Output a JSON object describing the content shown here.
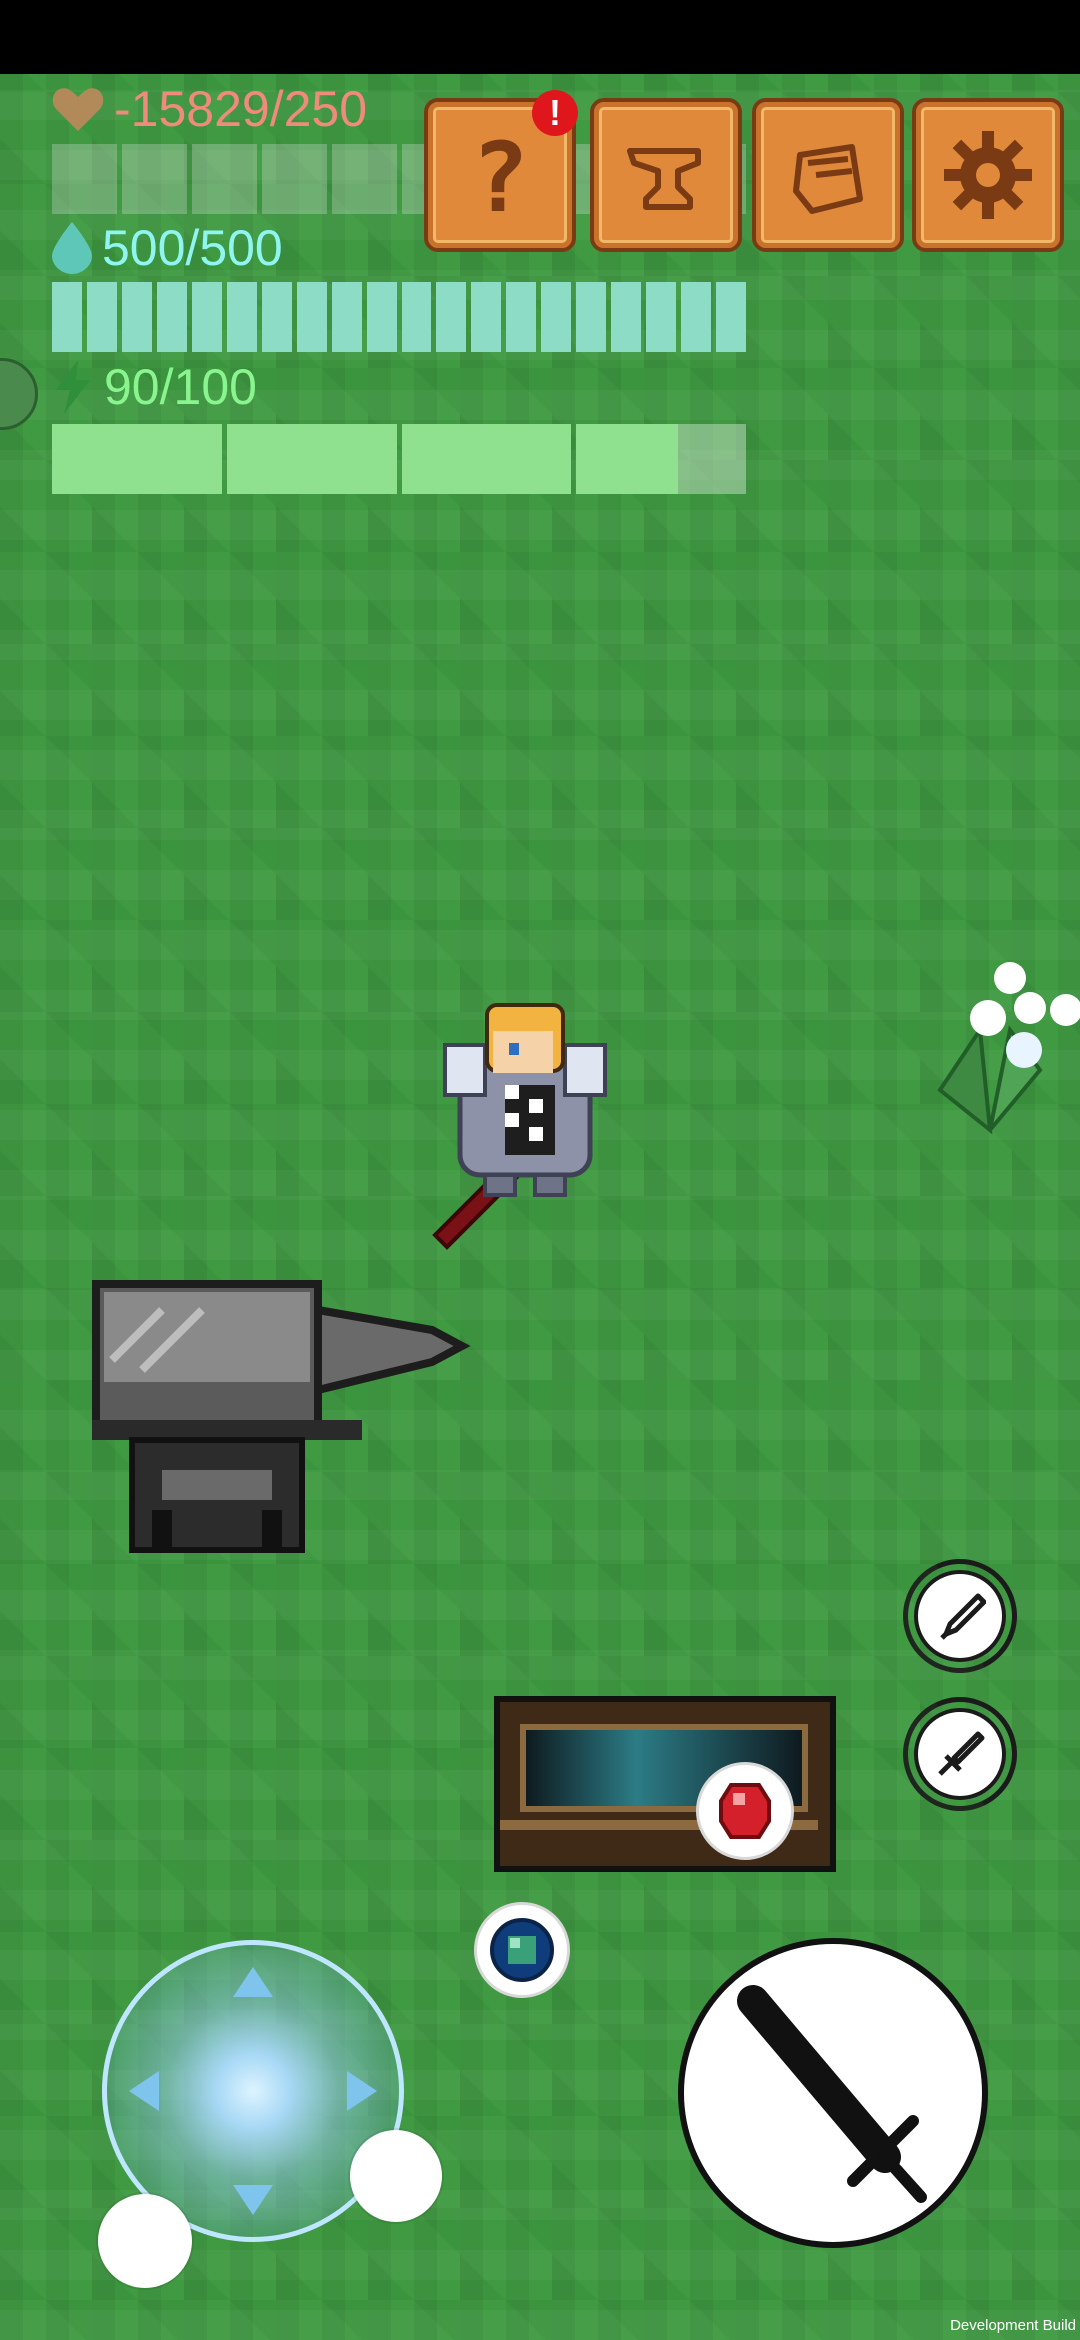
{
  "hud": {
    "health": {
      "icon": "heart-icon",
      "text": "-15829/250",
      "color": "#f08a7a",
      "fill": 0
    },
    "mana": {
      "icon": "water-drop-icon",
      "text": "500/500",
      "color": "#8ef5f0",
      "fill": 1.0
    },
    "energy": {
      "icon": "lightning-icon",
      "text": "90/100",
      "color": "#8af58f",
      "fill": 0.9
    }
  },
  "menu_buttons": [
    {
      "name": "help-button",
      "icon": "question-mark-icon",
      "label": "?"
    },
    {
      "name": "anvil-button",
      "icon": "anvil-icon"
    },
    {
      "name": "inventory-button",
      "icon": "backpack-icon"
    },
    {
      "name": "settings-button",
      "icon": "gear-icon"
    }
  ],
  "notification_badge": "!",
  "skills": [
    {
      "name": "skill-slot-1",
      "icon": "pen-blade-icon"
    },
    {
      "name": "skill-slot-2",
      "icon": "sword-icon"
    }
  ],
  "items": [
    {
      "name": "ruby-gem-item",
      "icon": "ruby-gem-icon",
      "color": "#d3202a"
    },
    {
      "name": "sapphire-gem-item",
      "icon": "sapphire-gem-icon",
      "color": "#1e6fb0"
    }
  ],
  "attack_button": {
    "icon": "sword-icon"
  },
  "watermark": "Development Build"
}
